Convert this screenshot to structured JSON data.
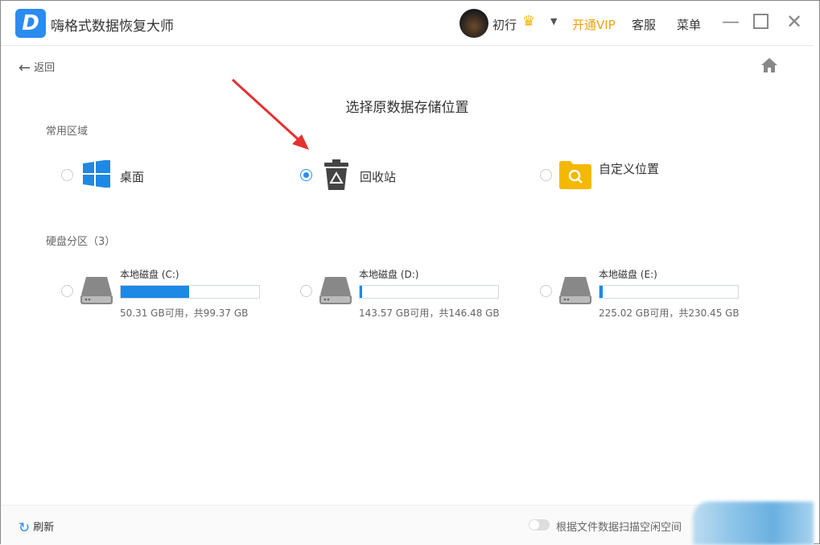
{
  "app": {
    "title": "嗨格式数据恢复大师",
    "logo_letter": "D"
  },
  "user": {
    "name": "初行",
    "vip_label": "开通VIP",
    "service_label": "客服",
    "menu_label": "菜单"
  },
  "nav": {
    "back_label": "返回"
  },
  "heading": "选择原数据存储位置",
  "common": {
    "title": "常用区域",
    "items": [
      {
        "label": "桌面",
        "selected": false
      },
      {
        "label": "回收站",
        "selected": true
      },
      {
        "label": "自定义位置",
        "selected": false
      }
    ]
  },
  "disks": {
    "title": "硬盘分区（3）",
    "items": [
      {
        "name": "本地磁盘 (C:)",
        "info": "50.31 GB可用，共99.37 GB",
        "used_fraction": 0.494
      },
      {
        "name": "本地磁盘 (D:)",
        "info": "143.57 GB可用，共146.48 GB",
        "used_fraction": 0.02
      },
      {
        "name": "本地磁盘 (E:)",
        "info": "225.02 GB可用，共230.45 GB",
        "used_fraction": 0.024
      }
    ]
  },
  "footer": {
    "refresh_label": "刷新",
    "scan_free_label": "根据文件数据扫描空闲空间",
    "scan_free_on": false
  }
}
